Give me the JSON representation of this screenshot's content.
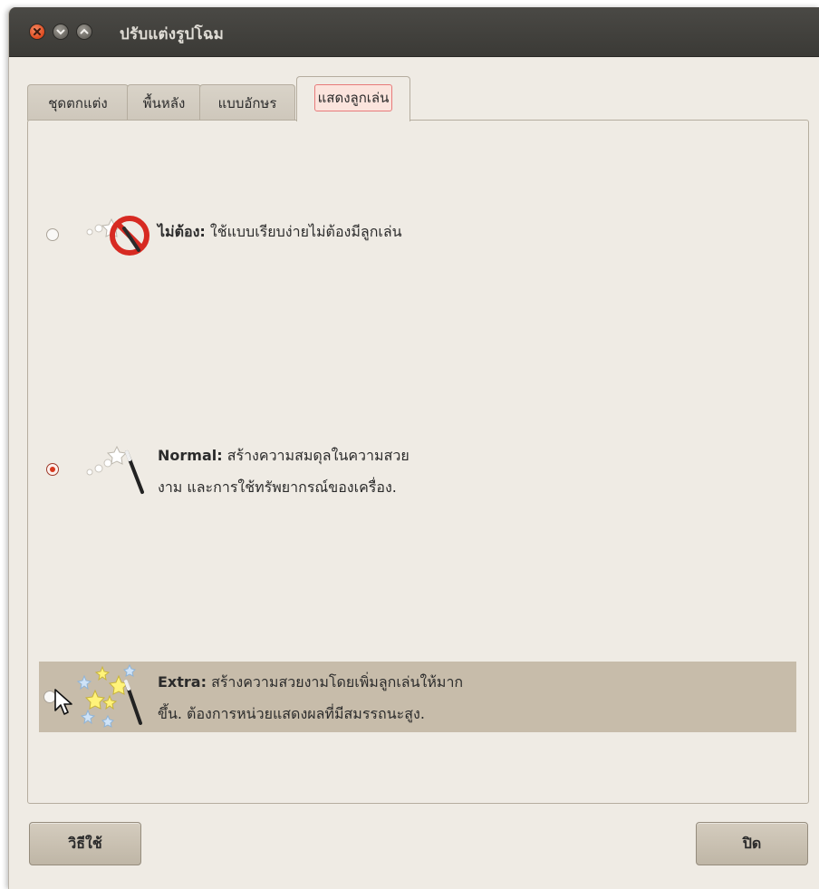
{
  "window": {
    "title": "ปรับแต่งรูปโฉม"
  },
  "tabs": [
    {
      "label": "ชุดตกแต่ง",
      "active": false
    },
    {
      "label": "พื้นหลัง",
      "active": false
    },
    {
      "label": "แบบอักษร",
      "active": false
    },
    {
      "label": "แสดงลูกเล่น",
      "active": true
    }
  ],
  "options": [
    {
      "bold": "ไม่ต้อง:",
      "line1": " ใช้แบบเรียบง่ายไม่ต้องมีลูกเล่น",
      "line2": "",
      "selected": false,
      "icon": "no-effects-icon"
    },
    {
      "bold": "Normal:",
      "line1": " สร้างความสมดุลในความสวย",
      "line2": "งาม และการใช้ทรัพยากรณ์ของเครื่อง.",
      "selected": true,
      "icon": "magic-wand-icon"
    },
    {
      "bold": "Extra:",
      "line1": " สร้างความสวยงามโดยเพิ่มลูกเล่นให้มาก",
      "line2": "ขึ้น. ต้องการหน่วยแสดงผลที่มีสมรรถนะสูง.",
      "selected": false,
      "icon": "sparkle-wand-icon"
    }
  ],
  "buttons": {
    "help": "วิธีใช้",
    "close": "ปิด"
  },
  "colors": {
    "accent": "#dd4a1f",
    "selected_radio": "#d7381e",
    "highlight": "#c7bcaa"
  }
}
